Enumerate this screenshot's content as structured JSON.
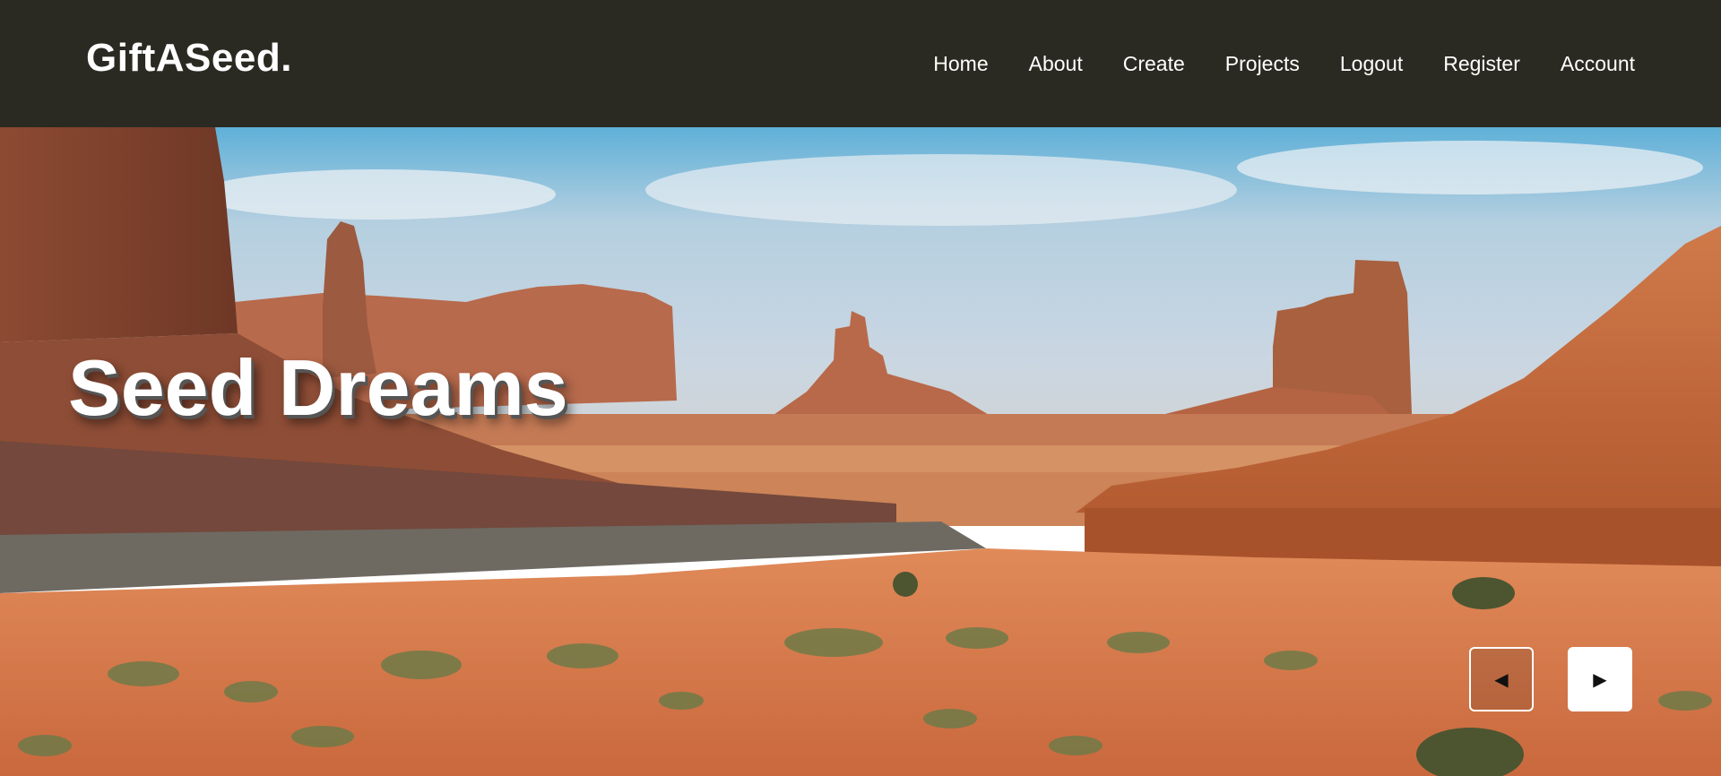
{
  "brand": {
    "logo": "GiftASeed."
  },
  "nav": {
    "items": [
      {
        "label": "Home"
      },
      {
        "label": "About"
      },
      {
        "label": "Create"
      },
      {
        "label": "Projects"
      },
      {
        "label": "Logout"
      },
      {
        "label": "Register"
      },
      {
        "label": "Account"
      }
    ]
  },
  "hero": {
    "title": "Seed Dreams",
    "controls": {
      "prev_icon": "◀",
      "next_icon": "▶"
    }
  },
  "colors": {
    "navbar_bg": "#2a2a22",
    "nav_text": "#ffffff",
    "sky": "#7fb6d6",
    "desert_sand": "#d27a4a",
    "rock": "#b5613c"
  },
  "icons": {
    "prev": "triangle-left-icon",
    "next": "triangle-right-icon"
  }
}
